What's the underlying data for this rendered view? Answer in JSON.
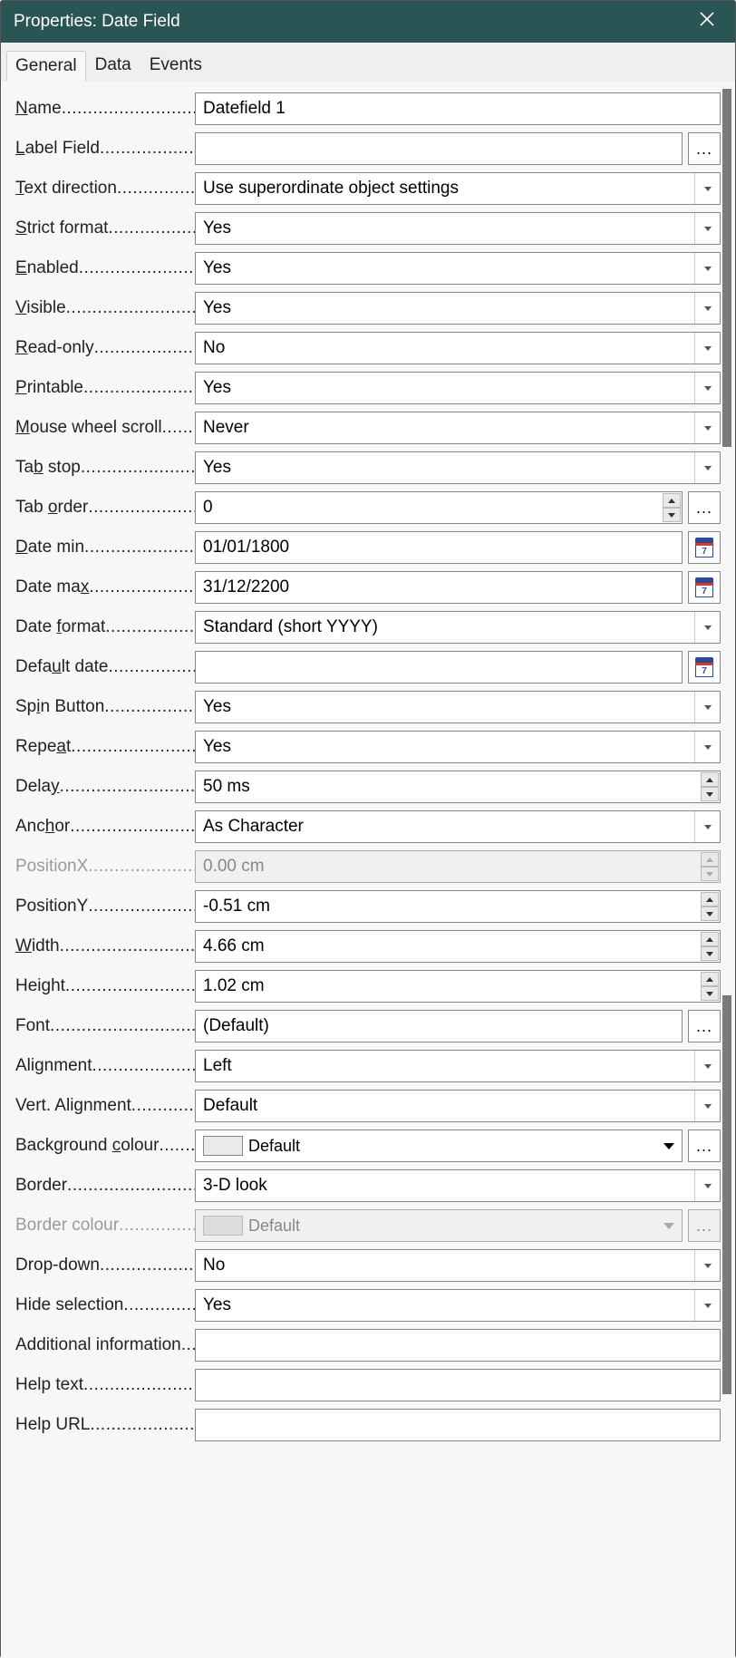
{
  "window": {
    "title": "Properties: Date Field"
  },
  "tabs": {
    "general": "General",
    "data": "Data",
    "events": "Events"
  },
  "labels": {
    "name": {
      "pre": "",
      "u": "N",
      "post": "ame"
    },
    "labelField": {
      "pre": "",
      "u": "L",
      "post": "abel Field"
    },
    "textDirection": {
      "pre": "",
      "u": "T",
      "post": "ext direction"
    },
    "strictFormat": {
      "pre": "",
      "u": "S",
      "post": "trict format"
    },
    "enabled": {
      "pre": "",
      "u": "E",
      "post": "nabled"
    },
    "visible": {
      "pre": "",
      "u": "V",
      "post": "isible"
    },
    "readOnly": {
      "pre": "",
      "u": "R",
      "post": "ead-only"
    },
    "printable": {
      "pre": "",
      "u": "P",
      "post": "rintable"
    },
    "mouseWheel": {
      "pre": "",
      "u": "M",
      "post": "ouse wheel scroll"
    },
    "tabStop": {
      "pre": "Ta",
      "u": "b",
      "post": " stop"
    },
    "tabOrder": {
      "pre": "Tab ",
      "u": "o",
      "post": "rder"
    },
    "dateMin": {
      "pre": "",
      "u": "D",
      "post": "ate min"
    },
    "dateMax": {
      "pre": "Date ma",
      "u": "x",
      "post": ""
    },
    "dateFormat": {
      "pre": "Date ",
      "u": "f",
      "post": "ormat"
    },
    "defaultDate": {
      "pre": "Defa",
      "u": "u",
      "post": "lt date"
    },
    "spinButton": {
      "pre": "Sp",
      "u": "i",
      "post": "n Button"
    },
    "repeat": {
      "pre": "Repe",
      "u": "a",
      "post": "t"
    },
    "delay": {
      "pre": "Dela",
      "u": "y",
      "post": ""
    },
    "anchor": {
      "pre": "Anc",
      "u": "h",
      "post": "or"
    },
    "positionX": {
      "simple": "PositionX"
    },
    "positionY": {
      "simple": "PositionY"
    },
    "width": {
      "pre": "",
      "u": "W",
      "post": "idth"
    },
    "height": {
      "simple": "Height"
    },
    "font": {
      "simple": "Font"
    },
    "alignment": {
      "simple": "Alignment"
    },
    "vertAlignment": {
      "simple": "Vert. Alignment"
    },
    "bgColor": {
      "pre": "Background ",
      "u": "c",
      "post": "olour"
    },
    "border": {
      "simple": "Border"
    },
    "borderColor": {
      "simple": "Border colour"
    },
    "dropdown": {
      "simple": "Drop-down"
    },
    "hideSelection": {
      "simple": "Hide selection"
    },
    "additionalInfo": {
      "simple": "Additional information"
    },
    "helpText": {
      "simple": "Help text"
    },
    "helpUrl": {
      "simple": "Help URL"
    }
  },
  "values": {
    "name": "Datefield 1",
    "labelField": "",
    "textDirection": "Use superordinate object settings",
    "strictFormat": "Yes",
    "enabled": "Yes",
    "visible": "Yes",
    "readOnly": "No",
    "printable": "Yes",
    "mouseWheel": "Never",
    "tabStop": "Yes",
    "tabOrder": "0",
    "dateMin": "01/01/1800",
    "dateMax": "31/12/2200",
    "dateFormat": "Standard (short YYYY)",
    "defaultDate": "",
    "spinButton": "Yes",
    "repeat": "Yes",
    "delay": "50 ms",
    "anchor": "As Character",
    "positionX": "0.00 cm",
    "positionY": "-0.51 cm",
    "width": "4.66 cm",
    "height": "1.02 cm",
    "font": "(Default)",
    "alignment": "Left",
    "vertAlignment": "Default",
    "bgColor": "Default",
    "border": "3-D look",
    "borderColor": "Default",
    "dropdown": "No",
    "hideSelection": "Yes",
    "additionalInfo": "",
    "helpText": "",
    "helpUrl": ""
  },
  "aux": {
    "ellipsis": "...",
    "cal7": "7"
  }
}
